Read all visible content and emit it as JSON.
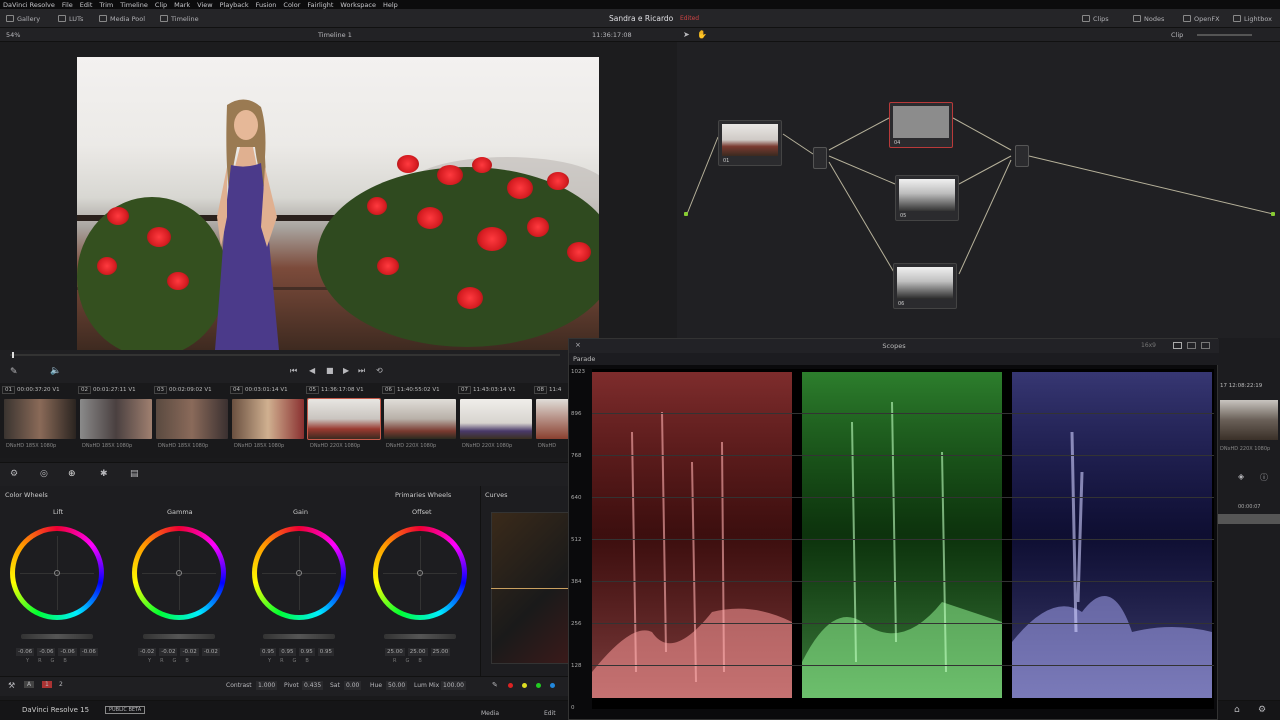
{
  "menu": [
    "DaVinci Resolve",
    "File",
    "Edit",
    "Trim",
    "Timeline",
    "Clip",
    "Mark",
    "View",
    "Playback",
    "Fusion",
    "Color",
    "Fairlight",
    "Workspace",
    "Help"
  ],
  "toolbar": {
    "gallery": "Gallery",
    "luts": "LUTs",
    "media_pool": "Media Pool",
    "timeline": "Timeline",
    "project": "Sandra e Ricardo",
    "edited": "Edited",
    "clips": "Clips",
    "nodes": "Nodes",
    "openfx": "OpenFX",
    "lightbox": "Lightbox"
  },
  "viewer": {
    "zoom": "54%",
    "timeline_name": "Timeline 1",
    "timecode": "11:36:17:08",
    "clip_mode": "Clip"
  },
  "nodes": [
    {
      "label": "01"
    },
    {
      "label": "04"
    },
    {
      "label": "05"
    },
    {
      "label": "06"
    }
  ],
  "clips": [
    {
      "num": "01",
      "tc": "00:00:37:20",
      "track": "V1",
      "format": "DNxHD 185X 1080p"
    },
    {
      "num": "02",
      "tc": "00:01:27:11",
      "track": "V1",
      "format": "DNxHD 185X 1080p"
    },
    {
      "num": "03",
      "tc": "00:02:09:02",
      "track": "V1",
      "format": "DNxHD 185X 1080p"
    },
    {
      "num": "04",
      "tc": "00:03:01:14",
      "track": "V1",
      "format": "DNxHD 185X 1080p"
    },
    {
      "num": "05",
      "tc": "11:36:17:08",
      "track": "V1",
      "format": "DNxHD 220X 1080p"
    },
    {
      "num": "06",
      "tc": "11:40:55:02",
      "track": "V1",
      "format": "DNxHD 220X 1080p"
    },
    {
      "num": "07",
      "tc": "11:43:03:14",
      "track": "V1",
      "format": "DNxHD 220X 1080p"
    },
    {
      "num": "08",
      "tc": "11:4",
      "track": "",
      "format": "DNxHD"
    }
  ],
  "right_clip": {
    "num": "17",
    "tc": "12:08:22:19",
    "format": "DNxHD 220X 1080p",
    "time": "00:00:07"
  },
  "color_wheels": {
    "title": "Color Wheels",
    "mode": "Primaries Wheels",
    "curves": "Curves",
    "wheels": [
      {
        "name": "Lift",
        "values": [
          "-0.06",
          "-0.06",
          "-0.06",
          "-0.06"
        ]
      },
      {
        "name": "Gamma",
        "values": [
          "-0.02",
          "-0.02",
          "-0.02",
          "-0.02"
        ]
      },
      {
        "name": "Gain",
        "values": [
          "0.95",
          "0.95",
          "0.95",
          "0.95"
        ]
      },
      {
        "name": "Offset",
        "values": [
          "25.00",
          "25.00",
          "25.00"
        ]
      }
    ],
    "channels4": [
      "Y",
      "R",
      "G",
      "B"
    ],
    "channels3": [
      "R",
      "G",
      "B"
    ]
  },
  "bottom": {
    "page1": "1",
    "page2": "2",
    "contrast_label": "Contrast",
    "contrast": "1.000",
    "pivot_label": "Pivot",
    "pivot": "0.435",
    "sat_label": "Sat",
    "sat": "0.00",
    "hue_label": "Hue",
    "hue": "50.00",
    "lummix_label": "Lum Mix",
    "lummix": "100.00"
  },
  "footer": {
    "app": "DaVinci Resolve 15",
    "beta": "PUBLIC BETA",
    "media": "Media",
    "edit": "Edit"
  },
  "scopes": {
    "title": "Scopes",
    "mode": "Parade",
    "ratio": "16x9",
    "y_ticks": [
      "1023",
      "896",
      "768",
      "640",
      "512",
      "384",
      "256",
      "128",
      "0"
    ]
  }
}
